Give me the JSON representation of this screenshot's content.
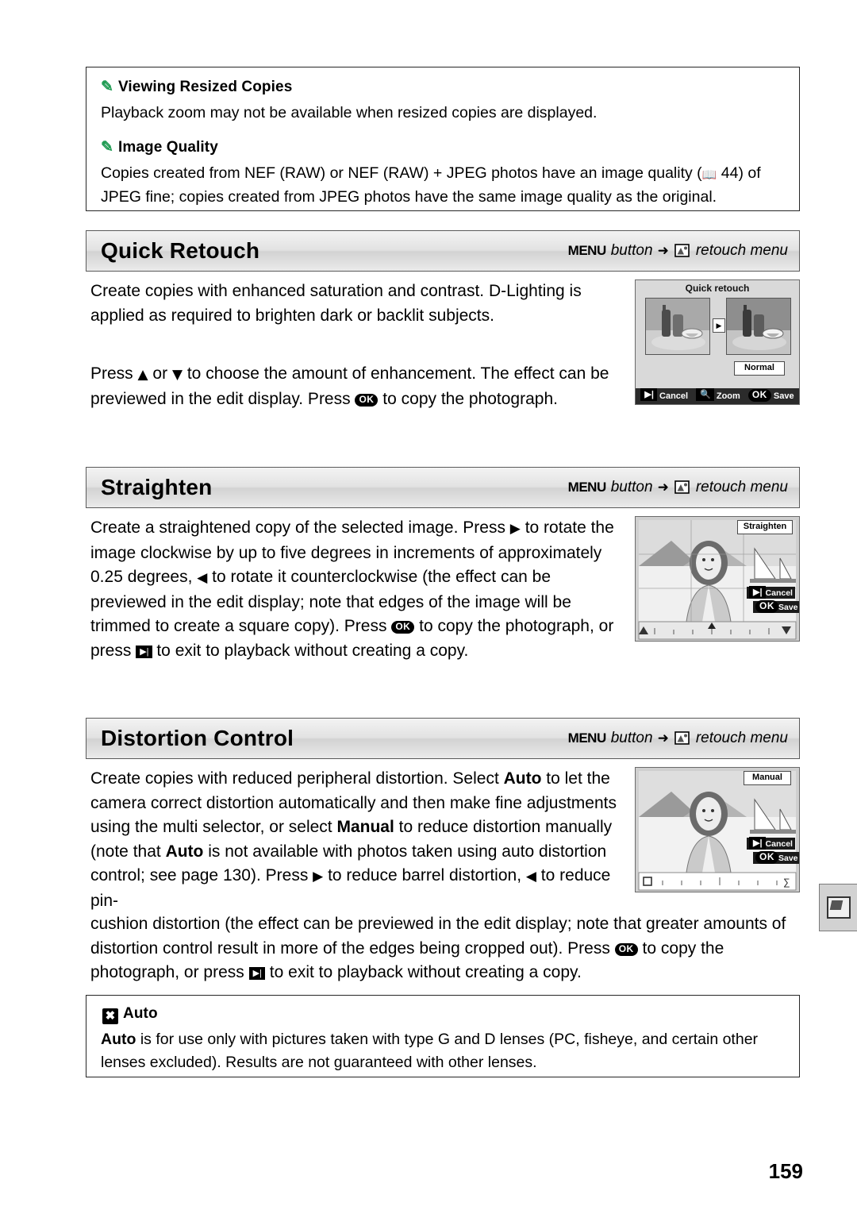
{
  "page_number": "159",
  "notes": [
    {
      "icon": "pencil-icon",
      "title": "Viewing Resized Copies",
      "body": "Playback zoom may not be available when resized copies are displayed."
    },
    {
      "icon": "pencil-icon",
      "title": "Image Quality",
      "body_part1": "Copies created from NEF (RAW) or NEF (RAW) + JPEG photos have an image quality (",
      "body_ref": "44",
      "body_part2": ") of JPEG fine; copies created from JPEG photos have the same image quality as the original."
    }
  ],
  "sections": [
    {
      "title": "Quick Retouch",
      "menu_badge": "MENU",
      "button_word": "button",
      "arrow": "➜",
      "menu_path": "retouch menu",
      "paragraphs": [
        "Create copies with enhanced saturation and contrast.  D-Lighting is applied as required to brighten dark or backlit subjects.",
        "Press ▲ or ▼ to choose the amount of enhancement.  The effect can be previewed in the edit display.  Press ⒪ to copy the photograph."
      ],
      "screen": {
        "title": "Quick retouch",
        "label": "Normal",
        "bottom_items": [
          "Cancel",
          "Zoom",
          "Save"
        ],
        "bottom_icons": [
          "playback-icon",
          "zoom-icon",
          "ok-icon"
        ]
      }
    },
    {
      "title": "Straighten",
      "menu_badge": "MENU",
      "button_word": "button",
      "arrow": "➜",
      "menu_path": "retouch menu",
      "paragraphs": [
        "Create a straightened copy of the selected image.  Press ▶ to rotate the image clockwise by up to five degrees in increments of approximately 0.25 degrees, ◀ to rotate it counterclockwise (the effect can be previewed in the edit display; note that edges of the image will be trimmed to create a square copy).  Press ⒪ to copy the photograph, or press ▶| to exit to playback without creating a copy."
      ],
      "screen": {
        "title": "Straighten",
        "buttons": [
          "Cancel",
          "Save"
        ],
        "button_icons": [
          "playback-icon",
          "ok-icon"
        ]
      }
    },
    {
      "title": "Distortion Control",
      "menu_badge": "MENU",
      "button_word": "button",
      "arrow": "➜",
      "menu_path": "retouch menu",
      "paragraphs": [
        "Create copies with reduced peripheral distortion.  Select Auto to let the camera correct distortion automatically and then make fine adjustments using the multi selector, or select Manual to reduce distortion manually (note that Auto is not available with photos taken using auto distortion control; see page 130).  Press ▶ to reduce barrel distortion, ◀ to reduce pin-cushion distortion  (the effect can be previewed in the edit display; note that greater amounts of distortion control result in more of the edges being cropped out).  Press ⒪ to copy the photograph, or press ▶| to exit to playback without creating a copy."
      ],
      "screen": {
        "title": "Manual",
        "buttons": [
          "Cancel",
          "Save"
        ],
        "button_icons": [
          "playback-icon",
          "ok-icon"
        ]
      }
    }
  ],
  "auto_note": {
    "icon": "warning-icon",
    "title": "Auto",
    "body": "Auto is for use only with pictures taken with type G and D lenses (PC, fisheye, and certain other lenses excluded).  Results are not guaranteed with other lenses."
  },
  "side_tab": {
    "icon": "retouch-menu-icon"
  }
}
